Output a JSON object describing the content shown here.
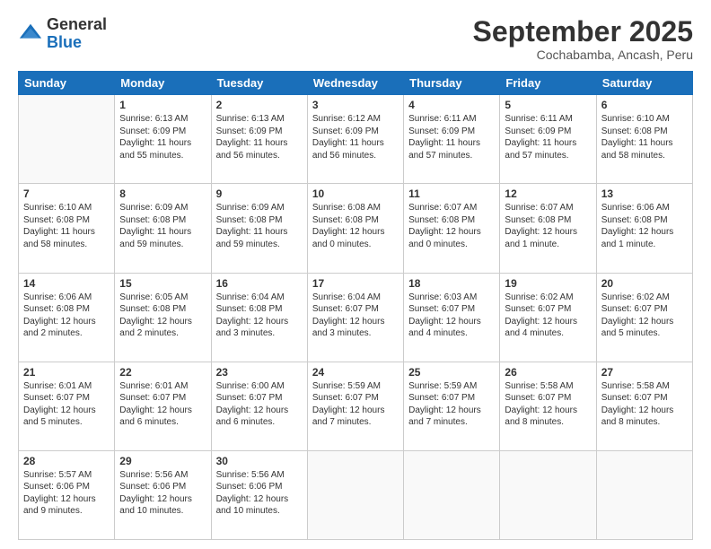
{
  "logo": {
    "general": "General",
    "blue": "Blue"
  },
  "title": "September 2025",
  "location": "Cochabamba, Ancash, Peru",
  "days_of_week": [
    "Sunday",
    "Monday",
    "Tuesday",
    "Wednesday",
    "Thursday",
    "Friday",
    "Saturday"
  ],
  "weeks": [
    [
      {
        "day": "",
        "content": ""
      },
      {
        "day": "1",
        "content": "Sunrise: 6:13 AM\nSunset: 6:09 PM\nDaylight: 11 hours\nand 55 minutes."
      },
      {
        "day": "2",
        "content": "Sunrise: 6:13 AM\nSunset: 6:09 PM\nDaylight: 11 hours\nand 56 minutes."
      },
      {
        "day": "3",
        "content": "Sunrise: 6:12 AM\nSunset: 6:09 PM\nDaylight: 11 hours\nand 56 minutes."
      },
      {
        "day": "4",
        "content": "Sunrise: 6:11 AM\nSunset: 6:09 PM\nDaylight: 11 hours\nand 57 minutes."
      },
      {
        "day": "5",
        "content": "Sunrise: 6:11 AM\nSunset: 6:09 PM\nDaylight: 11 hours\nand 57 minutes."
      },
      {
        "day": "6",
        "content": "Sunrise: 6:10 AM\nSunset: 6:08 PM\nDaylight: 11 hours\nand 58 minutes."
      }
    ],
    [
      {
        "day": "7",
        "content": "Sunrise: 6:10 AM\nSunset: 6:08 PM\nDaylight: 11 hours\nand 58 minutes."
      },
      {
        "day": "8",
        "content": "Sunrise: 6:09 AM\nSunset: 6:08 PM\nDaylight: 11 hours\nand 59 minutes."
      },
      {
        "day": "9",
        "content": "Sunrise: 6:09 AM\nSunset: 6:08 PM\nDaylight: 11 hours\nand 59 minutes."
      },
      {
        "day": "10",
        "content": "Sunrise: 6:08 AM\nSunset: 6:08 PM\nDaylight: 12 hours\nand 0 minutes."
      },
      {
        "day": "11",
        "content": "Sunrise: 6:07 AM\nSunset: 6:08 PM\nDaylight: 12 hours\nand 0 minutes."
      },
      {
        "day": "12",
        "content": "Sunrise: 6:07 AM\nSunset: 6:08 PM\nDaylight: 12 hours\nand 1 minute."
      },
      {
        "day": "13",
        "content": "Sunrise: 6:06 AM\nSunset: 6:08 PM\nDaylight: 12 hours\nand 1 minute."
      }
    ],
    [
      {
        "day": "14",
        "content": "Sunrise: 6:06 AM\nSunset: 6:08 PM\nDaylight: 12 hours\nand 2 minutes."
      },
      {
        "day": "15",
        "content": "Sunrise: 6:05 AM\nSunset: 6:08 PM\nDaylight: 12 hours\nand 2 minutes."
      },
      {
        "day": "16",
        "content": "Sunrise: 6:04 AM\nSunset: 6:08 PM\nDaylight: 12 hours\nand 3 minutes."
      },
      {
        "day": "17",
        "content": "Sunrise: 6:04 AM\nSunset: 6:07 PM\nDaylight: 12 hours\nand 3 minutes."
      },
      {
        "day": "18",
        "content": "Sunrise: 6:03 AM\nSunset: 6:07 PM\nDaylight: 12 hours\nand 4 minutes."
      },
      {
        "day": "19",
        "content": "Sunrise: 6:02 AM\nSunset: 6:07 PM\nDaylight: 12 hours\nand 4 minutes."
      },
      {
        "day": "20",
        "content": "Sunrise: 6:02 AM\nSunset: 6:07 PM\nDaylight: 12 hours\nand 5 minutes."
      }
    ],
    [
      {
        "day": "21",
        "content": "Sunrise: 6:01 AM\nSunset: 6:07 PM\nDaylight: 12 hours\nand 5 minutes."
      },
      {
        "day": "22",
        "content": "Sunrise: 6:01 AM\nSunset: 6:07 PM\nDaylight: 12 hours\nand 6 minutes."
      },
      {
        "day": "23",
        "content": "Sunrise: 6:00 AM\nSunset: 6:07 PM\nDaylight: 12 hours\nand 6 minutes."
      },
      {
        "day": "24",
        "content": "Sunrise: 5:59 AM\nSunset: 6:07 PM\nDaylight: 12 hours\nand 7 minutes."
      },
      {
        "day": "25",
        "content": "Sunrise: 5:59 AM\nSunset: 6:07 PM\nDaylight: 12 hours\nand 7 minutes."
      },
      {
        "day": "26",
        "content": "Sunrise: 5:58 AM\nSunset: 6:07 PM\nDaylight: 12 hours\nand 8 minutes."
      },
      {
        "day": "27",
        "content": "Sunrise: 5:58 AM\nSunset: 6:07 PM\nDaylight: 12 hours\nand 8 minutes."
      }
    ],
    [
      {
        "day": "28",
        "content": "Sunrise: 5:57 AM\nSunset: 6:06 PM\nDaylight: 12 hours\nand 9 minutes."
      },
      {
        "day": "29",
        "content": "Sunrise: 5:56 AM\nSunset: 6:06 PM\nDaylight: 12 hours\nand 10 minutes."
      },
      {
        "day": "30",
        "content": "Sunrise: 5:56 AM\nSunset: 6:06 PM\nDaylight: 12 hours\nand 10 minutes."
      },
      {
        "day": "",
        "content": ""
      },
      {
        "day": "",
        "content": ""
      },
      {
        "day": "",
        "content": ""
      },
      {
        "day": "",
        "content": ""
      }
    ]
  ]
}
